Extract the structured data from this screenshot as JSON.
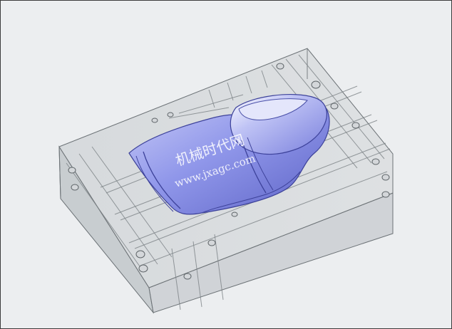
{
  "viewport": {
    "background": "#eceef0",
    "part_color": "#8f97ea",
    "mold_color": "#c4c8cc",
    "edge_color": "#5e6468"
  },
  "watermark": {
    "site_name": "机械时代网",
    "url": "www.jxagc.com"
  }
}
